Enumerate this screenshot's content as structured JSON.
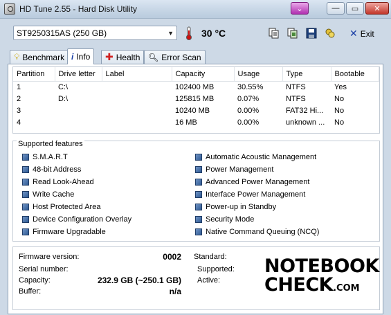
{
  "window": {
    "title": "HD Tune 2.55 - Hard Disk Utility",
    "min_glyph": "—",
    "max_glyph": "▭",
    "close_glyph": "✕"
  },
  "toolbar": {
    "drive": "ST9250315AS (250 GB)",
    "temperature": "30 °C",
    "exit_label": "Exit",
    "icons": [
      "copy-text-icon",
      "copy-screenshot-icon",
      "save-icon",
      "options-icon"
    ]
  },
  "tabs": [
    {
      "label": "Benchmark",
      "icon": "lightbulb-icon"
    },
    {
      "label": "Info",
      "icon": "info-icon",
      "active": true
    },
    {
      "label": "Health",
      "icon": "health-cross-icon"
    },
    {
      "label": "Error Scan",
      "icon": "magnifier-icon"
    }
  ],
  "partition_table": {
    "headers": [
      "Partition",
      "Drive letter",
      "Label",
      "Capacity",
      "Usage",
      "Type",
      "Bootable"
    ],
    "rows": [
      [
        "1",
        "C:\\",
        "",
        "102400 MB",
        "30.55%",
        "NTFS",
        "Yes"
      ],
      [
        "2",
        "D:\\",
        "",
        "125815 MB",
        "0.07%",
        "NTFS",
        "No"
      ],
      [
        "3",
        "",
        "",
        "10240 MB",
        "0.00%",
        "FAT32 Hi...",
        "No"
      ],
      [
        "4",
        "",
        "",
        "16 MB",
        "0.00%",
        "unknown ...",
        "No"
      ]
    ]
  },
  "supported_features": {
    "title": "Supported features",
    "left": [
      "S.M.A.R.T",
      "48-bit Address",
      "Read Look-Ahead",
      "Write Cache",
      "Host Protected Area",
      "Device Configuration Overlay",
      "Firmware Upgradable"
    ],
    "right": [
      "Automatic Acoustic Management",
      "Power Management",
      "Advanced Power Management",
      "Interface Power Management",
      "Power-up in Standby",
      "Security Mode",
      "Native Command Queuing (NCQ)"
    ]
  },
  "drive_info": {
    "firmware_label": "Firmware version:",
    "firmware_value": "0002",
    "serial_label": "Serial number:",
    "serial_value": "",
    "capacity_label": "Capacity:",
    "capacity_value": "232.9 GB (~250.1 GB)",
    "buffer_label": "Buffer:",
    "buffer_value": "n/a",
    "standard_label": "Standard:",
    "supported_label": "Supported:",
    "active_label": "Active:"
  },
  "watermark": {
    "line1": "NOTEBOOK",
    "line2": "CHECK",
    "suffix": ".COM"
  },
  "colors": {
    "window_bg": "#cdd9e6",
    "feature_box": "#2f5a94",
    "health_cross": "#d02020",
    "close_button": "#c2362a"
  }
}
